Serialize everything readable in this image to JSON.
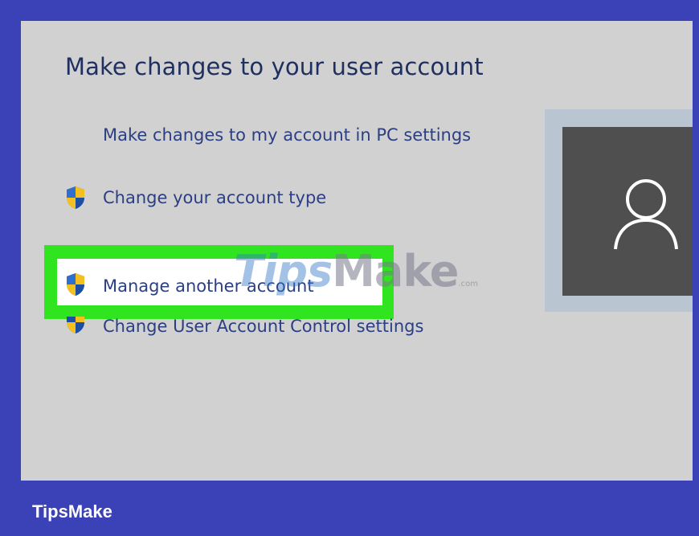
{
  "panel": {
    "title": "Make changes to your user account",
    "links": {
      "pc_settings": "Make changes to my account in PC settings",
      "account_type": "Change your account type",
      "manage_another": "Manage another account",
      "uac_settings": "Change User Account Control settings"
    }
  },
  "watermark": {
    "tips": "Tips",
    "make": "Make",
    "domain": ".com"
  },
  "footer": {
    "brand": "TipsMake"
  },
  "icons": {
    "shield": "uac-shield-icon",
    "user": "user-avatar-icon"
  },
  "colors": {
    "frame": "#3b41b7",
    "panel": "#d1d1d1",
    "highlight": "#30e51f",
    "link": "#2b3f82",
    "title": "#1f2f5f",
    "avatar_bg": "#4f4f4f"
  }
}
